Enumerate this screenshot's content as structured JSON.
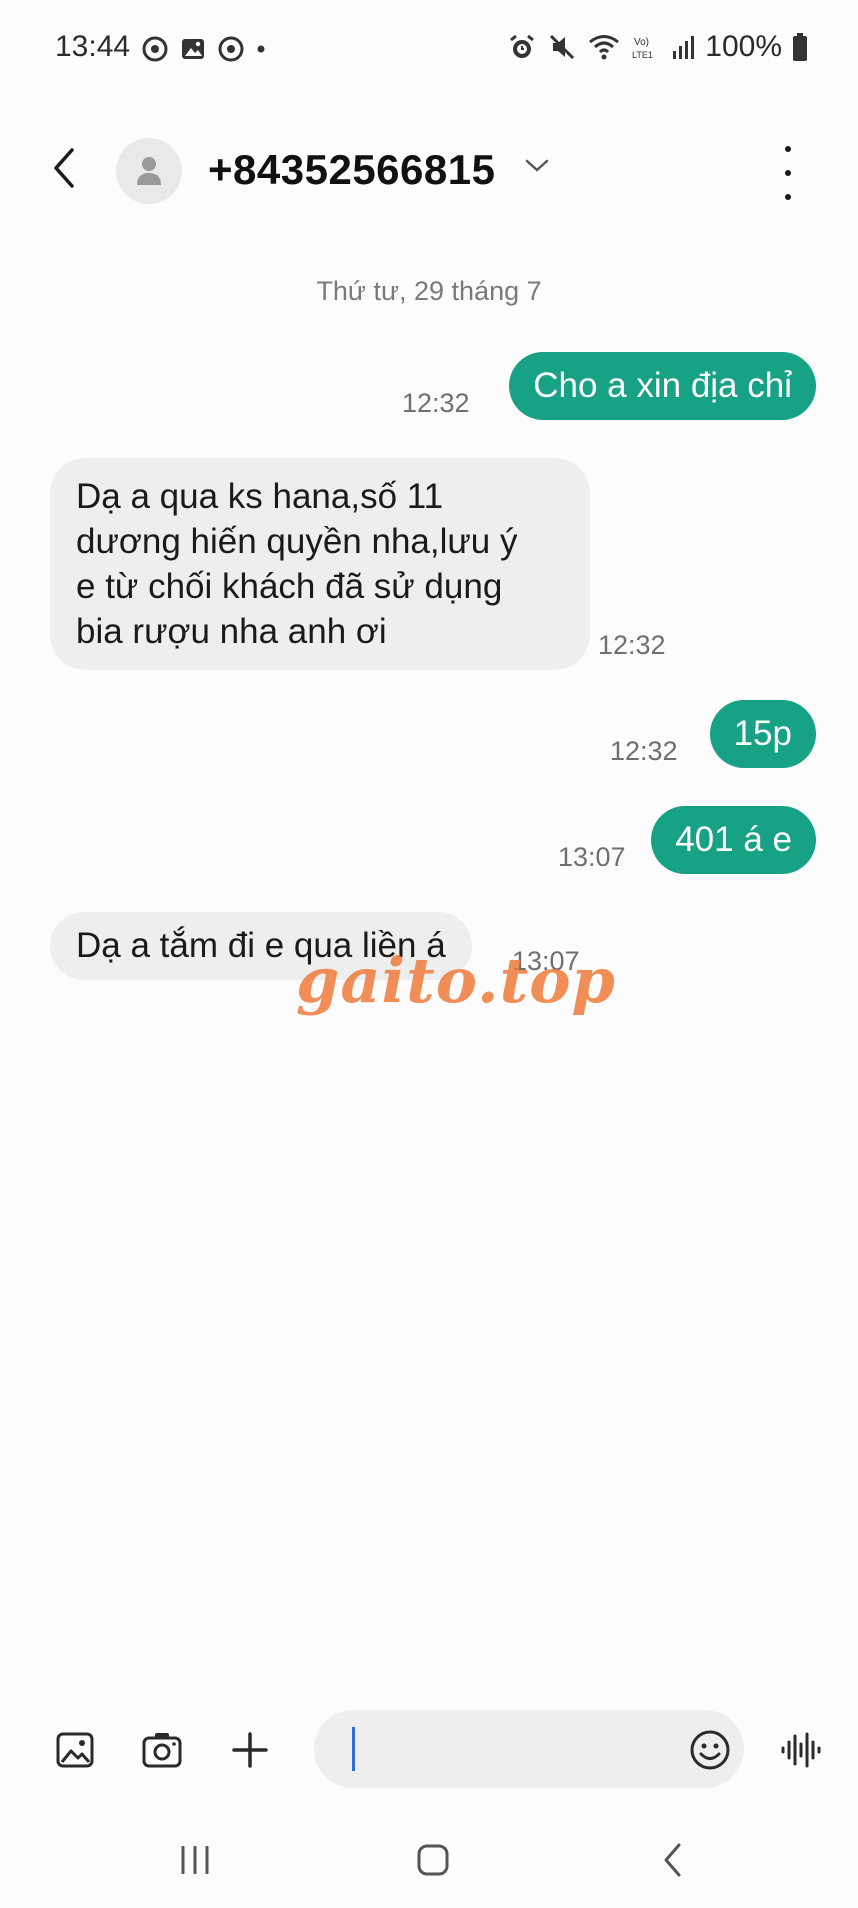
{
  "status_bar": {
    "time": "13:44",
    "battery": "100%",
    "left_icons": [
      "chrome-icon",
      "gallery-icon",
      "chrome-icon",
      "dot-icon"
    ],
    "right_icons": [
      "alarm-icon",
      "mute-icon",
      "wifi-icon",
      "volte-icon",
      "signal-icon",
      "battery-icon"
    ]
  },
  "header": {
    "contact": "+84352566815",
    "back_icon": "back-arrow-icon",
    "avatar_icon": "person-icon",
    "dropdown_icon": "chevron-down-icon",
    "menu_icon": "more-vertical-icon"
  },
  "conversation": {
    "date": "Thứ tư, 29 tháng 7",
    "messages": [
      {
        "direction": "outgoing",
        "text": "Cho a xin địa chỉ",
        "time": "12:32"
      },
      {
        "direction": "incoming",
        "lines": [
          "Dạ a qua ks hana,số 11",
          "dương hiến quyền nha,lưu ý",
          "e từ chối khách đã sử dụng",
          "bia rượu nha anh ơi"
        ],
        "time": "12:32"
      },
      {
        "direction": "outgoing",
        "text": "15p",
        "time": "12:32"
      },
      {
        "direction": "outgoing",
        "text": "401 á e",
        "time": "13:07"
      },
      {
        "direction": "incoming",
        "lines": [
          "Dạ a tắm đi e qua liền á"
        ],
        "time": "13:07"
      }
    ]
  },
  "watermark": "gaito.top",
  "composer": {
    "input_value": "",
    "gallery_icon": "gallery-icon",
    "camera_icon": "camera-icon",
    "add_icon": "plus-icon",
    "emoji_icon": "emoji-icon",
    "voice_icon": "voice-wave-icon"
  },
  "colors": {
    "outgoing_bubble": "#17a285",
    "incoming_bubble": "#eeeeee",
    "background": "#fcfcfc",
    "watermark": "#f07a3a"
  },
  "nav": {
    "recents_icon": "recents-icon",
    "home_icon": "home-icon",
    "back_icon": "nav-back-icon"
  }
}
